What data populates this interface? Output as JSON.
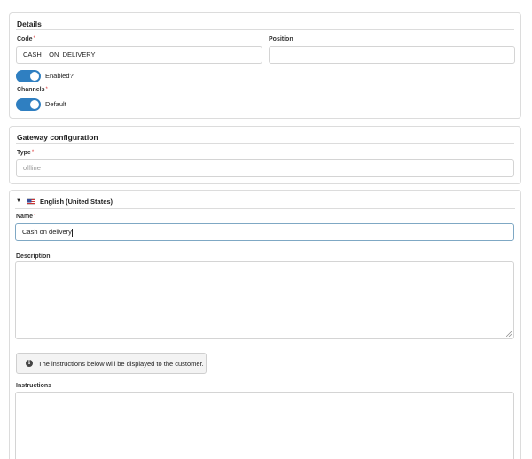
{
  "details": {
    "title": "Details",
    "code_label": "Code",
    "code_value": "CASH__ON_DELIVERY",
    "position_label": "Position",
    "position_value": "",
    "enabled_label": "Enabled?",
    "enabled": true,
    "channels_label": "Channels",
    "channel_default_label": "Default",
    "channel_default_on": true
  },
  "gateway": {
    "title": "Gateway configuration",
    "type_label": "Type",
    "type_value": "offline"
  },
  "translation": {
    "language": "English (United States)",
    "name_label": "Name",
    "name_value": "Cash on delivery",
    "description_label": "Description",
    "description_value": "",
    "notice": "The instructions below will be displayed to the customer.",
    "instructions_label": "Instructions",
    "instructions_value": ""
  },
  "required_marker": "*",
  "colors": {
    "toggle_on": "#2f7fc1",
    "border": "#dcdcdc",
    "required": "#dd3333"
  },
  "icons": {
    "expand": "triangle-down-icon",
    "flag": "us-flag-icon",
    "info": "info-circle-icon"
  }
}
